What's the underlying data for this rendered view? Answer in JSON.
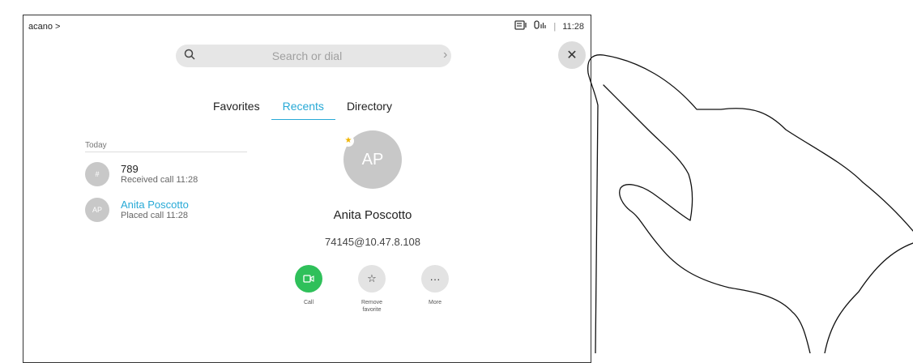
{
  "topbar": {
    "breadcrumb": "acano >",
    "time": "11:28"
  },
  "search": {
    "placeholder": "Search or dial"
  },
  "tabs": [
    {
      "label": "Favorites",
      "active": false
    },
    {
      "label": "Recents",
      "active": true
    },
    {
      "label": "Directory",
      "active": false
    }
  ],
  "recents": {
    "section_label": "Today",
    "items": [
      {
        "avatar": "#",
        "name": "789",
        "detail": "Received call 11:28"
      },
      {
        "avatar": "AP",
        "name": "Anita Poscotto",
        "detail": "Placed call 11:28"
      }
    ]
  },
  "contact": {
    "initials": "AP",
    "name": "Anita Poscotto",
    "address": "74145@10.47.8.108"
  },
  "actions": [
    {
      "label": "Call",
      "icon": "video-camera-icon"
    },
    {
      "label": "Remove favorite",
      "icon": "star-icon"
    },
    {
      "label": "More",
      "icon": "more-icon"
    }
  ],
  "colors": {
    "accent": "#27a9d6",
    "call_green": "#2fc05a",
    "favorite_star": "#f0b400"
  }
}
